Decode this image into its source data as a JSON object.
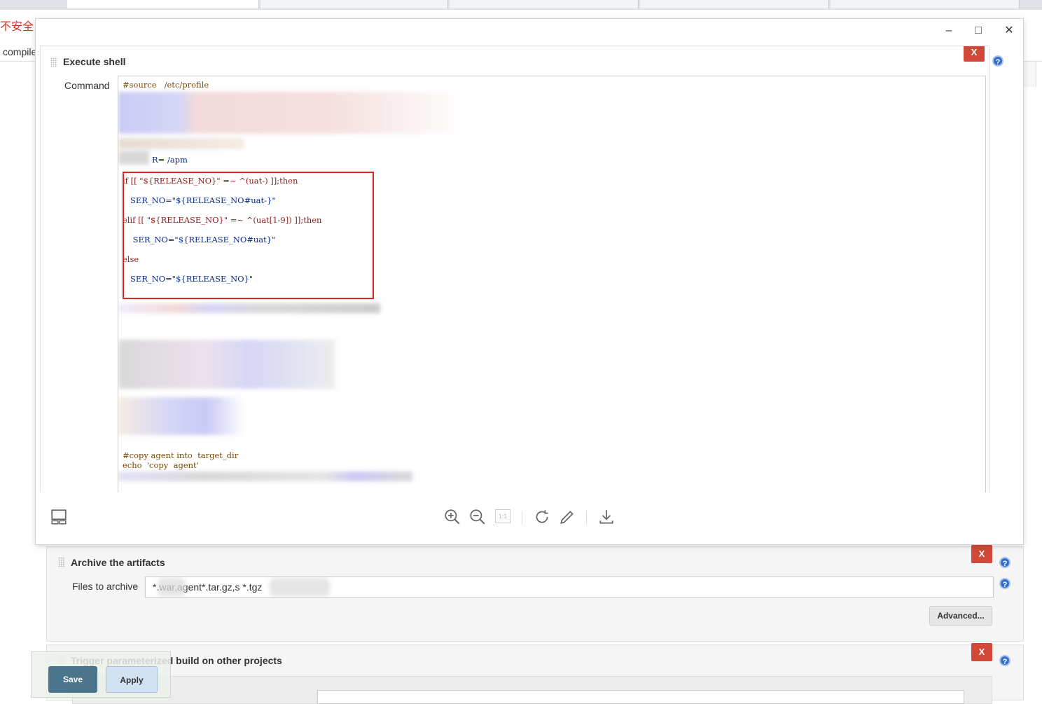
{
  "browser": {
    "security_warning": "不安全",
    "breadcrumb_fragment": "compile"
  },
  "viewer": {
    "window_controls": [
      "minimize-icon",
      "maximize-icon",
      "close-icon"
    ],
    "toolbar_icons": [
      "thumbnail-icon",
      "zoom-in-icon",
      "zoom-out-icon",
      "actual-size-icon",
      "rotate-icon",
      "edit-icon",
      "download-icon"
    ],
    "actual_size_label": "1:1"
  },
  "execute_shell": {
    "title": "Execute shell",
    "delete_label": "X",
    "help_label": "?",
    "command_label": "Command",
    "code_lines": [
      {
        "text": "#source   /etc/profile",
        "kind": "comment"
      },
      {
        "text": "R= /apm",
        "kind": "plain"
      },
      {
        "text": "if [[ \"${RELEASE_NO}\" =~ ^(uat-) ]];then",
        "kind": "kw"
      },
      {
        "text": "   SER_NO=\"${RELEASE_NO#uat-}\"",
        "kind": "plain"
      },
      {
        "text": "elif [[ \"${RELEASE_NO}\" =~ ^(uat[1-9]) ]];then",
        "kind": "kw"
      },
      {
        "text": "    SER_NO=\"${RELEASE_NO#uat}\"",
        "kind": "plain"
      },
      {
        "text": "else",
        "kind": "kw"
      },
      {
        "text": "   SER_NO=\"${RELEASE_NO}\"",
        "kind": "plain"
      },
      {
        "text": "#copy agent into  target_dir",
        "kind": "comment"
      },
      {
        "text": "echo  'copy  agent'",
        "kind": "comment"
      }
    ]
  },
  "archive": {
    "title": "Archive the artifacts",
    "delete_label": "X",
    "help_label": "?",
    "files_label": "Files to archive",
    "files_value": "*.war,agent*.tar.gz,s        *.tgz",
    "advanced_label": "Advanced..."
  },
  "trigger": {
    "title": "Trigger parameterized build on other projects",
    "delete_label": "X",
    "help_label": "?"
  },
  "actions": {
    "save_label": "Save",
    "apply_label": "Apply"
  }
}
